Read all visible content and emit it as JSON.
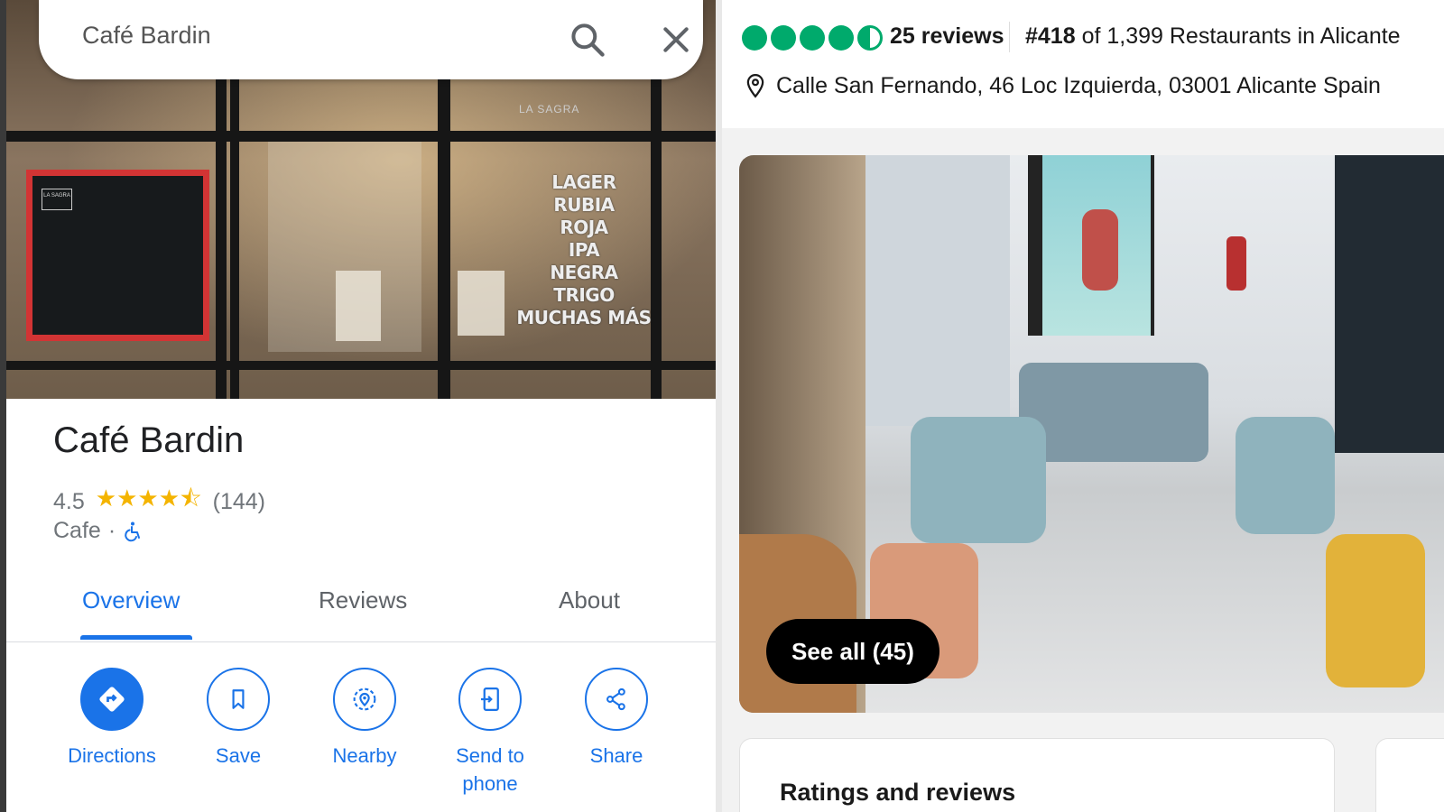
{
  "maps": {
    "search": {
      "query": "Café Bardin"
    },
    "hero": {
      "window_sign": "LA SAGRA",
      "board_tag": "LA SAGRA",
      "beer_list": [
        "LAGER",
        "RUBIA",
        "ROJA",
        "IPA",
        "NEGRA",
        "TRIGO",
        "MUCHAS MÁS"
      ]
    },
    "place": {
      "name": "Café Bardin",
      "rating": "4.5",
      "stars_glyph": "★★★★⯪",
      "review_count": "(144)",
      "category": "Cafe",
      "separator": "·"
    },
    "tabs": [
      {
        "label": "Overview",
        "active": true
      },
      {
        "label": "Reviews",
        "active": false
      },
      {
        "label": "About",
        "active": false
      }
    ],
    "actions": [
      {
        "label": "Directions",
        "icon": "directions-icon"
      },
      {
        "label": "Save",
        "icon": "bookmark-icon"
      },
      {
        "label": "Nearby",
        "icon": "nearby-icon"
      },
      {
        "label": "Send to phone",
        "label_line1": "Send to",
        "label_line2": "phone",
        "icon": "send-to-phone-icon"
      },
      {
        "label": "Share",
        "icon": "share-icon"
      }
    ],
    "colors": {
      "accent": "#1a73e8",
      "star": "#f4b400",
      "secondary_text": "#70757a"
    }
  },
  "tripadvisor": {
    "rating_bubbles": 4.5,
    "review_count": "25 reviews",
    "rank_prefix": "#418",
    "rank_rest": "of 1,399 Restaurants in Alicante",
    "address": "Calle San Fernando, 46 Loc Izquierda, 03001 Alicante Spain",
    "see_all": "See all (45)",
    "section_title": "Ratings and reviews",
    "colors": {
      "bubble": "#00aa6c"
    }
  }
}
